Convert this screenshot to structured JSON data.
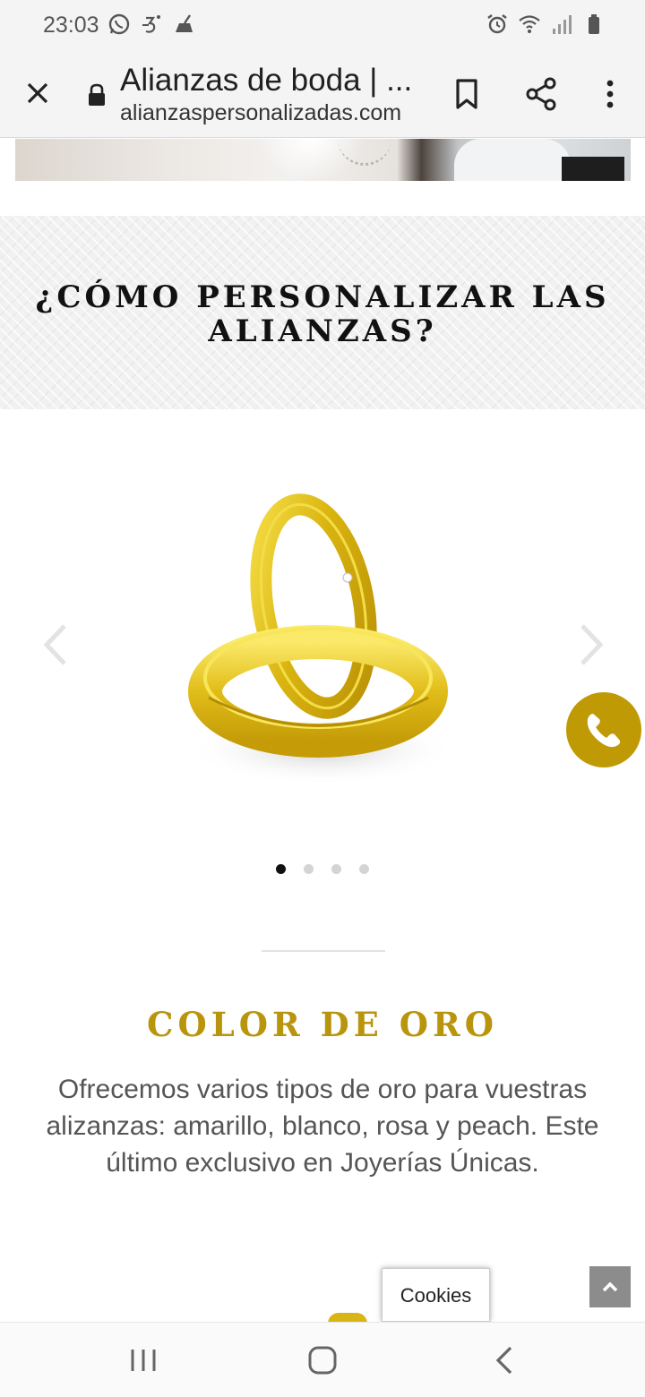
{
  "status_bar": {
    "time": "23:03",
    "left_icons": [
      "whatsapp-icon",
      "sound-3d-icon",
      "cleaner-icon"
    ],
    "right_icons": [
      "alarm-icon",
      "wifi-icon",
      "signal-icon",
      "battery-icon"
    ]
  },
  "browser": {
    "title": "Alianzas de boda | ...",
    "url": "alianzaspersonalizadas.com"
  },
  "section": {
    "heading": "¿CÓMO PERSONALIZAR LAS ALIANZAS?"
  },
  "carousel": {
    "slide_count": 4,
    "active_index": 0
  },
  "feature": {
    "heading": "COLOR DE ORO",
    "description": "Ofrecemos varios tipos de oro para vuestras alizanzas: amarillo, blanco, rosa y peach. Este último exclusivo en Joyerías Únicas."
  },
  "cookies": {
    "label": "Cookies"
  },
  "colors": {
    "accent_gold": "#c09a05",
    "heading_gold": "#b8950c"
  }
}
